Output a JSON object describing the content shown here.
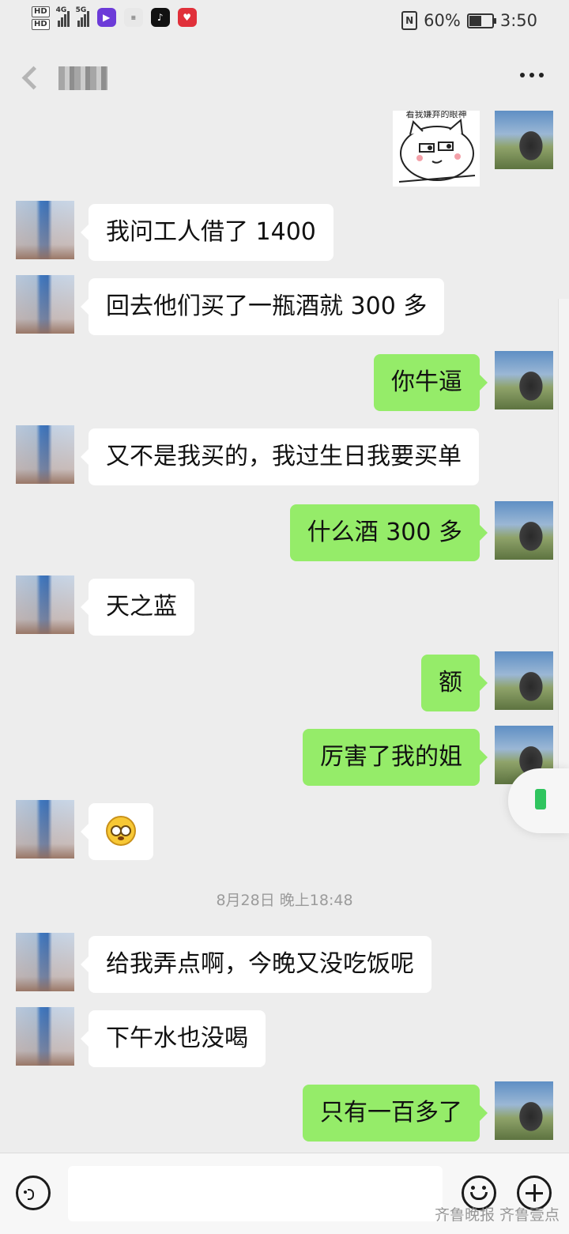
{
  "status_bar": {
    "hd1": "HD",
    "hd2": "HD",
    "net1": "4G",
    "net2": "5G",
    "battery_text": "60%",
    "battery_level": 0.6,
    "time": "3:50",
    "nfc": "N"
  },
  "header": {
    "contact_name": "",
    "back_icon": "chevron-left-icon",
    "menu_icon": "more-dots-icon"
  },
  "messages": [
    {
      "side": "right",
      "type": "sticker",
      "caption": "看我嫌弃的眼神"
    },
    {
      "side": "left",
      "text": "我问工人借了 1400"
    },
    {
      "side": "left",
      "text": "回去他们买了一瓶酒就 300 多"
    },
    {
      "side": "right",
      "text": "你牛逼"
    },
    {
      "side": "left",
      "text": "又不是我买的，我过生日我要买单"
    },
    {
      "side": "right",
      "text": "什么酒 300 多"
    },
    {
      "side": "left",
      "text": "天之蓝"
    },
    {
      "side": "right",
      "text": "额"
    },
    {
      "side": "right",
      "text": "厉害了我的姐"
    },
    {
      "side": "left",
      "type": "emoji",
      "emoji": "dazed-face-icon"
    },
    {
      "side": "left",
      "text": "给我弄点啊，今晚又没吃饭呢"
    },
    {
      "side": "left",
      "text": "下午水也没喝"
    },
    {
      "side": "right",
      "text": "只有一百多了"
    }
  ],
  "timestamp": "8月28日 晚上18:48",
  "input_bar": {
    "voice_icon": "voice-icon",
    "emoji_icon": "emoji-icon",
    "plus_icon": "plus-icon",
    "input_value": ""
  },
  "watermark": "齐鲁晚报 齐鲁壹点",
  "colors": {
    "background": "#ededed",
    "my_bubble": "#95ec69",
    "their_bubble": "#ffffff",
    "timestamp": "#9b9b9b"
  }
}
